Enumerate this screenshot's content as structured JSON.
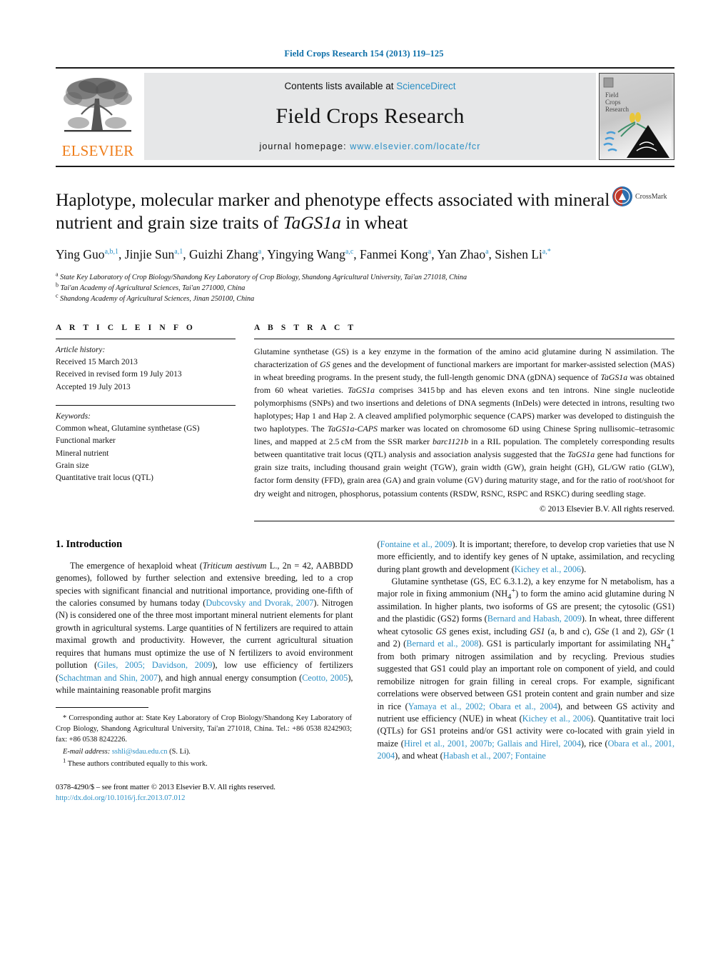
{
  "running_head": "Field Crops Research 154 (2013) 119–125",
  "masthead": {
    "publisher": "ELSEVIER",
    "contents_prefix": "Contents lists available at ",
    "contents_link": "ScienceDirect",
    "journal_name": "Field Crops Research",
    "homepage_prefix": "journal homepage: ",
    "homepage_url": "www.elsevier.com/locate/fcr",
    "cover_title_lines": [
      "Field",
      "Crops",
      "Research"
    ]
  },
  "article": {
    "title_part1": "Haplotype, molecular marker and phenotype effects associated with mineral nutrient and grain size traits of ",
    "title_gene": "TaGS1a",
    "title_part2": " in wheat",
    "crossmark_label": "CrossMark",
    "authors": "Ying Guo, Jinjie Sun, Guizhi Zhang, Yingying Wang, Fanmei Kong, Yan Zhao, Sishen Li",
    "affiliations": [
      "State Key Laboratory of Crop Biology/Shandong Key Laboratory of Crop Biology, Shandong Agricultural University, Tai'an 271018, China",
      "Tai'an Academy of Agricultural Sciences, Tai'an 271000, China",
      "Shandong Academy of Agricultural Sciences, Jinan 250100, China"
    ]
  },
  "article_info": {
    "heading": "A R T I C L E  I N F O",
    "history_label": "Article history:",
    "history": [
      "Received 15 March 2013",
      "Received in revised form 19 July 2013",
      "Accepted 19 July 2013"
    ],
    "keywords_label": "Keywords:",
    "keywords": [
      "Common wheat, Glutamine synthetase (GS)",
      "Functional marker",
      "Mineral nutrient",
      "Grain size",
      "Quantitative trait locus (QTL)"
    ]
  },
  "abstract": {
    "heading": "A B S T R A C T",
    "copyright": "© 2013 Elsevier B.V. All rights reserved."
  },
  "sections": {
    "intro_heading": "1.  Introduction"
  },
  "footnotes": {
    "corresponding_star": "*",
    "corresponding": " Corresponding author at: State Key Laboratory of Crop Biology/Shandong Key Laboratory of Crop Biology, Shandong Agricultural University, Tai'an 271018, China. Tel.: +86 0538 8242903; fax: +86 0538 8242226.",
    "email_label": "E-mail address:",
    "email": "sshli@sdau.edu.cn",
    "email_suffix": " (S. Li).",
    "equal_marker": "1",
    "equal_contrib": " These authors contributed equally to this work."
  },
  "imprint": {
    "line1": "0378-4290/$ – see front matter © 2013 Elsevier B.V. All rights reserved.",
    "doi": "http://dx.doi.org/10.1016/j.fcr.2013.07.012"
  },
  "colors": {
    "link": "#2b8fc4",
    "elsevier_orange": "#ef7d1a",
    "header_blue": "#0c6ea8"
  }
}
